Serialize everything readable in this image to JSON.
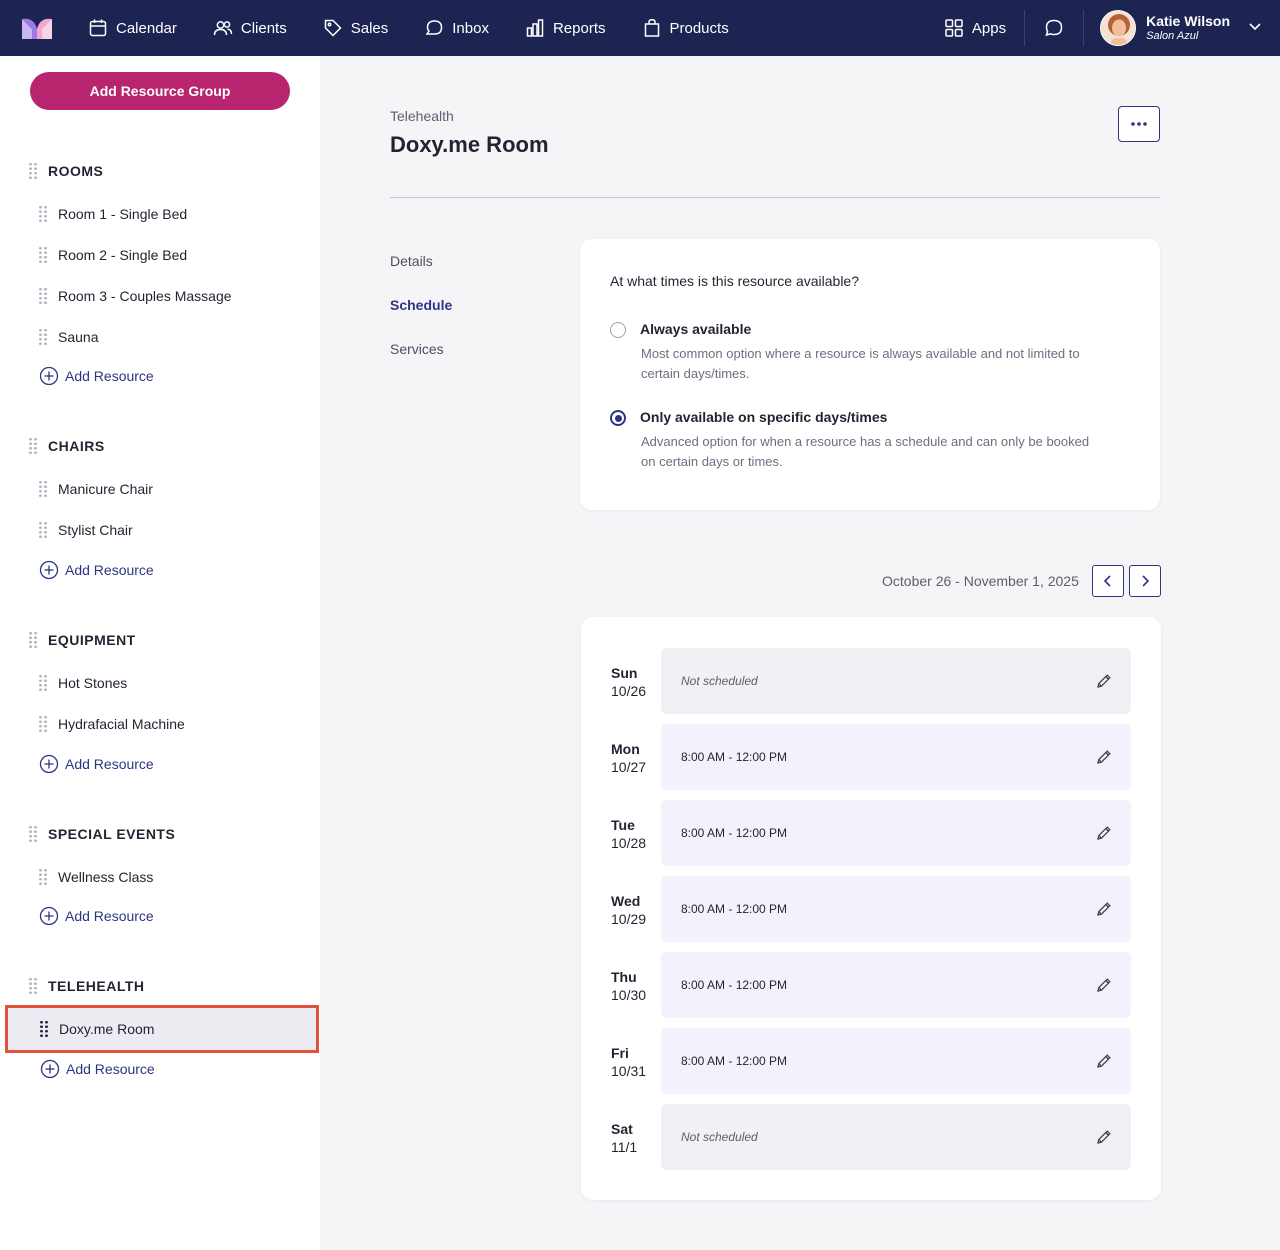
{
  "nav": {
    "items": [
      {
        "label": "Calendar",
        "icon": "calendar-icon"
      },
      {
        "label": "Clients",
        "icon": "users-icon"
      },
      {
        "label": "Sales",
        "icon": "tag-icon"
      },
      {
        "label": "Inbox",
        "icon": "chat-bubble-icon"
      },
      {
        "label": "Reports",
        "icon": "bar-chart-icon"
      },
      {
        "label": "Products",
        "icon": "shopping-bag-icon"
      }
    ],
    "apps_label": "Apps",
    "user_name": "Katie Wilson",
    "user_org": "Salon Azul"
  },
  "sidebar": {
    "add_group_label": "Add Resource Group",
    "add_resource_label": "Add Resource",
    "groups": [
      {
        "title": "ROOMS",
        "items": [
          "Room 1 - Single Bed",
          "Room 2 - Single Bed",
          "Room 3 - Couples Massage",
          "Sauna"
        ]
      },
      {
        "title": "CHAIRS",
        "items": [
          "Manicure Chair",
          "Stylist Chair"
        ]
      },
      {
        "title": "EQUIPMENT",
        "items": [
          "Hot Stones",
          "Hydrafacial Machine"
        ]
      },
      {
        "title": "SPECIAL EVENTS",
        "items": [
          "Wellness Class"
        ]
      },
      {
        "title": "TELEHEALTH",
        "items": [
          "Doxy.me Room"
        ]
      }
    ],
    "selected": "Doxy.me Room"
  },
  "header": {
    "breadcrumb": "Telehealth",
    "title": "Doxy.me Room"
  },
  "subnav": {
    "items": [
      "Details",
      "Schedule",
      "Services"
    ],
    "active": "Schedule"
  },
  "availability": {
    "question": "At what times is this resource available?",
    "options": [
      {
        "label": "Always available",
        "description": "Most common option where a resource is always available and not limited to certain days/times.",
        "selected": false
      },
      {
        "label": "Only available on specific days/times",
        "description": "Advanced option for when a resource has a schedule and can only be booked on certain days or times.",
        "selected": true
      }
    ]
  },
  "schedule": {
    "date_range": "October 26 - November 1, 2025",
    "days": [
      {
        "day": "Sun",
        "date": "10/26",
        "hours": "Not scheduled",
        "scheduled": false
      },
      {
        "day": "Mon",
        "date": "10/27",
        "hours": "8:00 AM - 12:00 PM",
        "scheduled": true
      },
      {
        "day": "Tue",
        "date": "10/28",
        "hours": "8:00 AM - 12:00 PM",
        "scheduled": true
      },
      {
        "day": "Wed",
        "date": "10/29",
        "hours": "8:00 AM - 12:00 PM",
        "scheduled": true
      },
      {
        "day": "Thu",
        "date": "10/30",
        "hours": "8:00 AM - 12:00 PM",
        "scheduled": true
      },
      {
        "day": "Fri",
        "date": "10/31",
        "hours": "8:00 AM - 12:00 PM",
        "scheduled": true
      },
      {
        "day": "Sat",
        "date": "11/1",
        "hours": "Not scheduled",
        "scheduled": false
      }
    ]
  },
  "colors": {
    "nav_bg": "#1d2452",
    "accent": "#2d3583",
    "brand_button": "#b8246d",
    "selection_outline": "#e2523d"
  }
}
